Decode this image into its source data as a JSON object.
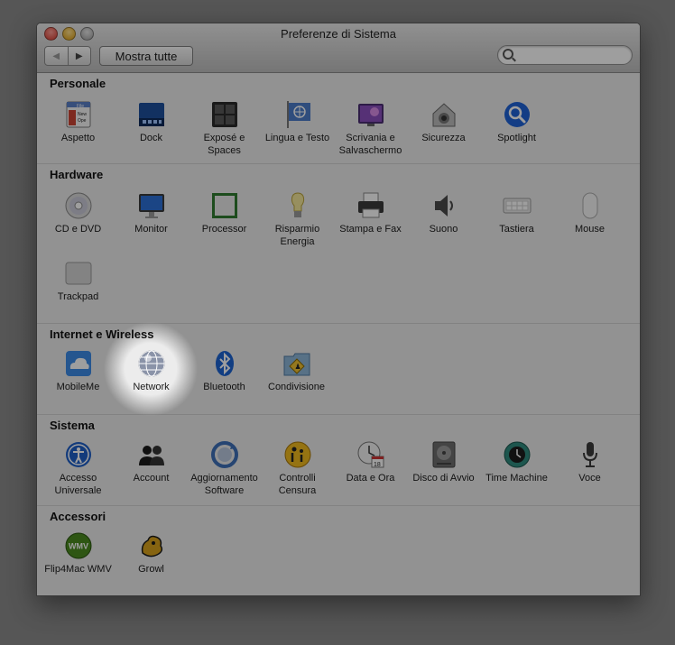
{
  "window": {
    "title": "Preferenze di Sistema",
    "back_icon": "back-arrow-icon",
    "forward_icon": "forward-arrow-icon",
    "show_all_label": "Mostra tutte",
    "search": {
      "value": "",
      "placeholder": ""
    }
  },
  "sections": [
    {
      "title": "Personale",
      "items": [
        {
          "label": "Aspetto",
          "icon": "appearance-icon"
        },
        {
          "label": "Dock",
          "icon": "dock-icon"
        },
        {
          "label": "Exposé e Spaces",
          "icon": "expose-spaces-icon"
        },
        {
          "label": "Lingua e Testo",
          "icon": "language-text-icon"
        },
        {
          "label": "Scrivania e Salvaschermo",
          "icon": "desktop-screensaver-icon"
        },
        {
          "label": "Sicurezza",
          "icon": "security-icon"
        },
        {
          "label": "Spotlight",
          "icon": "spotlight-icon"
        }
      ]
    },
    {
      "title": "Hardware",
      "items": [
        {
          "label": "CD e DVD",
          "icon": "cd-dvd-icon"
        },
        {
          "label": "Monitor",
          "icon": "monitor-icon"
        },
        {
          "label": "Processor",
          "icon": "processor-icon"
        },
        {
          "label": "Risparmio Energia",
          "icon": "energy-saver-icon"
        },
        {
          "label": "Stampa e Fax",
          "icon": "print-fax-icon"
        },
        {
          "label": "Suono",
          "icon": "sound-icon"
        },
        {
          "label": "Tastiera",
          "icon": "keyboard-icon"
        },
        {
          "label": "Mouse",
          "icon": "mouse-icon"
        },
        {
          "label": "Trackpad",
          "icon": "trackpad-icon"
        }
      ]
    },
    {
      "title": "Internet e Wireless",
      "items": [
        {
          "label": "MobileMe",
          "icon": "mobileme-icon"
        },
        {
          "label": "Network",
          "icon": "network-icon"
        },
        {
          "label": "Bluetooth",
          "icon": "bluetooth-icon"
        },
        {
          "label": "Condivisione",
          "icon": "sharing-icon"
        }
      ]
    },
    {
      "title": "Sistema",
      "items": [
        {
          "label": "Accesso Universale",
          "icon": "universal-access-icon"
        },
        {
          "label": "Account",
          "icon": "accounts-icon"
        },
        {
          "label": "Aggiornamento Software",
          "icon": "software-update-icon"
        },
        {
          "label": "Controlli Censura",
          "icon": "parental-controls-icon"
        },
        {
          "label": "Data e Ora",
          "icon": "date-time-icon"
        },
        {
          "label": "Disco di Avvio",
          "icon": "startup-disk-icon"
        },
        {
          "label": "Time Machine",
          "icon": "time-machine-icon"
        },
        {
          "label": "Voce",
          "icon": "speech-icon"
        }
      ]
    },
    {
      "title": "Accessori",
      "items": [
        {
          "label": "Flip4Mac WMV",
          "icon": "flip4mac-icon",
          "badge": "WMV"
        },
        {
          "label": "Growl",
          "icon": "growl-icon"
        }
      ]
    }
  ],
  "highlighted_item": "Network"
}
